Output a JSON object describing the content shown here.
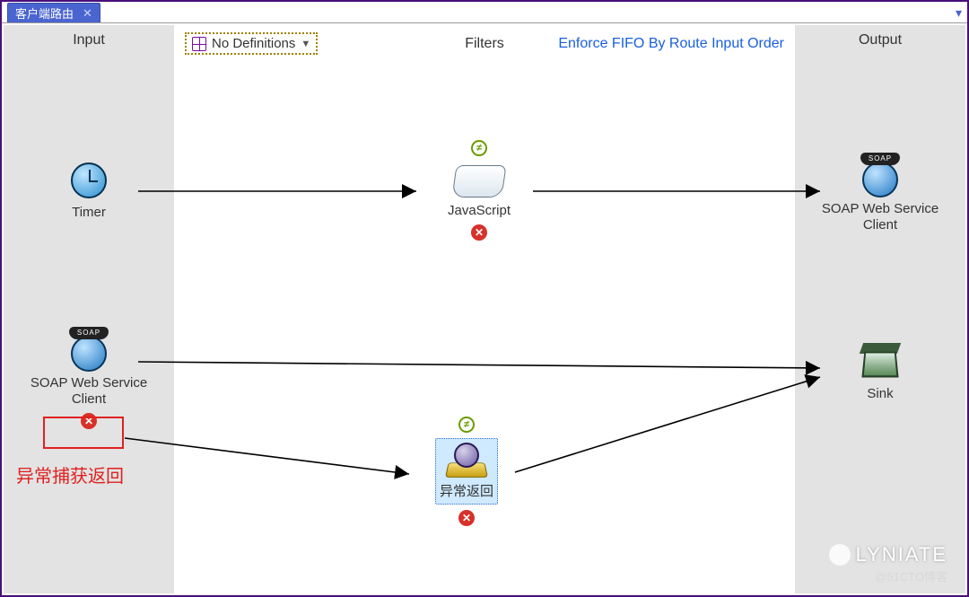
{
  "tab": {
    "title": "客户端路由"
  },
  "columns": {
    "input": "Input",
    "filters": "Filters",
    "output": "Output"
  },
  "toolbar": {
    "no_definitions": "No Definitions",
    "enforce_fifo": "Enforce FIFO By Route Input Order"
  },
  "nodes": {
    "timer": {
      "label": "Timer"
    },
    "javascript": {
      "label": "JavaScript"
    },
    "soap_out": {
      "label": "SOAP Web Service Client"
    },
    "soap_in": {
      "label": "SOAP Web Service Client"
    },
    "sink": {
      "label": "Sink"
    },
    "exception_return": {
      "label": "异常返回"
    }
  },
  "badges": {
    "soap_cap": "SOAP",
    "not_equal": "≠",
    "error_x": "✕"
  },
  "callout": {
    "label": "异常捕获返回"
  },
  "watermark": {
    "brand": "LYNIATE",
    "sub": "@51CTO博客"
  }
}
